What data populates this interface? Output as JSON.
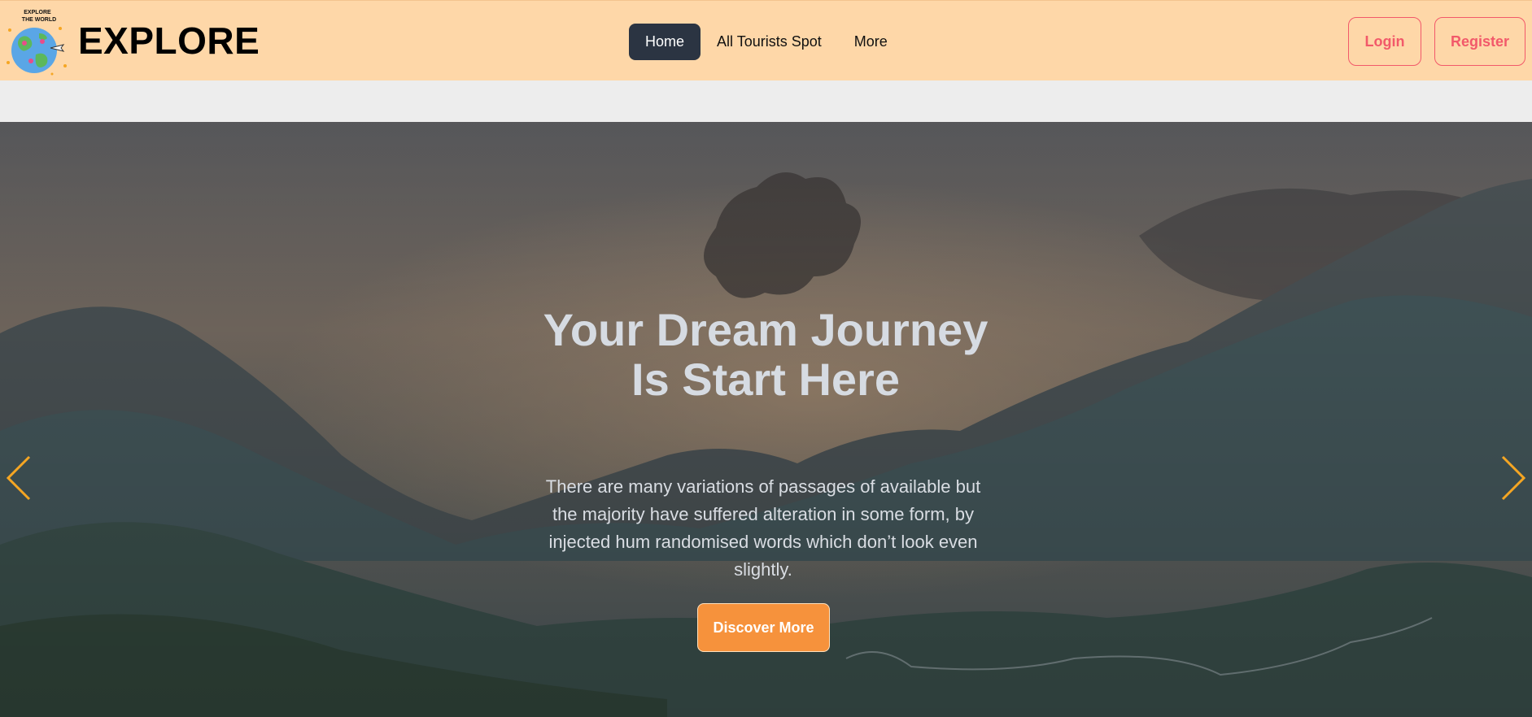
{
  "nav": {
    "brand": "EXPLORE",
    "logo_text": [
      "EXPLORE",
      "THE WORLD"
    ],
    "links": [
      {
        "label": "Home",
        "active": true
      },
      {
        "label": "All Tourists Spot",
        "active": false
      },
      {
        "label": "More",
        "active": false
      }
    ],
    "login": "Login",
    "register": "Register"
  },
  "hero": {
    "title": "Your Dream Journey Is Start Here",
    "text": "There are many variations of passages of available but the majority have suffered alteration in some form, by injected hum randomised words which don’t look even slightly.",
    "cta": "Discover More",
    "prev_icon": "chevron-left-icon",
    "next_icon": "chevron-right-icon"
  },
  "colors": {
    "navbar_bg": "#fed7a8",
    "nav_active_bg": "#2b3442",
    "auth_accent": "#f2596a",
    "cta_bg": "#f6923c",
    "arrow_color": "#f5a623"
  }
}
